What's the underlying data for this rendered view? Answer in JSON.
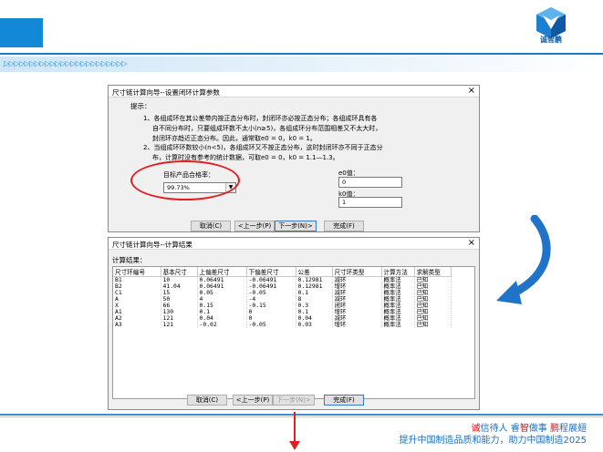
{
  "slide": {
    "logo_text": "诚智鹏",
    "slogan_line1_red_a": "诚",
    "slogan_line1_a": "信待人 睿",
    "slogan_line1_red_b": "智",
    "slogan_line1_b": "做事 ",
    "slogan_line1_red_c": "鹏",
    "slogan_line1_c": "程展翅",
    "slogan_line2": "提升中国制造品质和能力，助力中国制造2025"
  },
  "dialog1": {
    "title": "尺寸链计算向导--设置闭环计算参数",
    "close": "×",
    "hint_label": "提示：",
    "hint_lines": [
      "1、各组成环在其公差带内按正态分布时，封闭环亦必按正态分布；各组成环具有各",
      "自不同分布时，只要组成环数不太小(n≥5)，各组成环分布范围相差又不太大时，",
      "封闭环亦趋近正态分布。因此，通常取e0 = 0，k0 = 1。",
      "2、当组成环环数较小(n<5)，各组成环又不按正态分布，这时封闭环亦不同于正态分",
      "布，计算时没有参考的统计数据，可取e0 = 0，k0 = 1.1—1.3。"
    ],
    "target_label": "目标产品合格率：",
    "target_value": "99.73%",
    "dropdown_icon": "▼",
    "e0_label": "e0值：",
    "e0_value": "0",
    "k0_label": "k0值：",
    "k0_value": "1",
    "buttons": {
      "cancel": "取消(C)",
      "prev": "<上一步(P)",
      "next": "下一步(N)>",
      "finish": "完成(F)"
    }
  },
  "dialog2": {
    "title": "尺寸链计算向导--计算结果",
    "close": "×",
    "result_label": "计算结果：",
    "columns": [
      "尺寸环编号",
      "基本尺寸",
      "上偏差尺寸",
      "下偏差尺寸",
      "公差",
      "尺寸环类型",
      "计算方法",
      "求解类型"
    ],
    "rows": [
      [
        "B1",
        "10",
        "0.06491",
        "-0.06491",
        "0.12981",
        "减环",
        "概率法",
        "已知"
      ],
      [
        "B2",
        "41.04",
        "0.06491",
        "-0.06491",
        "0.12981",
        "增环",
        "概率法",
        "已知"
      ],
      [
        "C1",
        "15",
        "0.05",
        "-0.05",
        "0.1",
        "减环",
        "概率法",
        "已知"
      ],
      [
        "A",
        "50",
        "4",
        "-4",
        "8",
        "减环",
        "概率法",
        "已知"
      ],
      [
        "X",
        "66",
        "0.15",
        "-0.15",
        "0.3",
        "闭环",
        "概率法",
        "已知"
      ],
      [
        "A1",
        "130",
        "0.1",
        "0",
        "0.1",
        "增环",
        "概率法",
        "已知"
      ],
      [
        "A2",
        "121",
        "0.04",
        "0",
        "0.04",
        "减环",
        "概率法",
        "已知"
      ],
      [
        "A3",
        "121",
        "-0.02",
        "-0.05",
        "0.03",
        "增环",
        "概率法",
        "已知"
      ]
    ],
    "buttons": {
      "cancel": "取消(C)",
      "prev": "<上一步(P)",
      "next": "下一步(N)>",
      "finish": "完成(F)"
    }
  }
}
